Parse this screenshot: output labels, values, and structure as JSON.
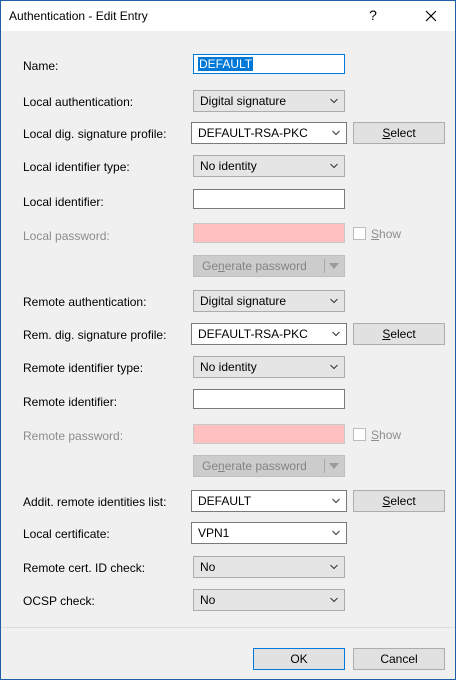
{
  "window": {
    "title": "Authentication - Edit Entry",
    "help_label": "?",
    "close_label": "×"
  },
  "fields": {
    "name": {
      "label": "Name:",
      "value": "DEFAULT"
    },
    "local_authentication": {
      "label": "Local authentication:",
      "value": "Digital signature"
    },
    "local_sig_profile": {
      "label": "Local dig. signature profile:",
      "value": "DEFAULT-RSA-PKC"
    },
    "local_identifier_type": {
      "label": "Local identifier type:",
      "value": "No identity"
    },
    "local_identifier": {
      "label": "Local identifier:",
      "value": ""
    },
    "local_password": {
      "label": "Local password:",
      "value": "",
      "show_label_pre": "",
      "show_label_ul": "S",
      "show_label_post": "how"
    },
    "remote_authentication": {
      "label": "Remote authentication:",
      "value": "Digital signature"
    },
    "remote_sig_profile": {
      "label": "Rem. dig. signature profile:",
      "value": "DEFAULT-RSA-PKC"
    },
    "remote_identifier_type": {
      "label": "Remote identifier type:",
      "value": "No identity"
    },
    "remote_identifier": {
      "label": "Remote identifier:",
      "value": ""
    },
    "remote_password": {
      "label": "Remote password:",
      "value": "",
      "show_label_pre": "",
      "show_label_ul": "S",
      "show_label_post": "how"
    },
    "addit_remote_identities": {
      "label": "Addit. remote identities list:",
      "value": "DEFAULT"
    },
    "local_certificate": {
      "label": "Local certificate:",
      "value": "VPN1"
    },
    "remote_cert_id_check": {
      "label": "Remote cert. ID check:",
      "value": "No"
    },
    "ocsp_check": {
      "label": "OCSP check:",
      "value": "No"
    }
  },
  "buttons": {
    "select_pre": "",
    "select_ul": "S",
    "select_post": "elect",
    "generate_pre": "Ge",
    "generate_ul": "n",
    "generate_post": "erate password",
    "ok": "OK",
    "cancel": "Cancel"
  },
  "colors": {
    "accent": "#0078d7",
    "password_bg": "#ffc0c0",
    "window_border": "#1f5fa8"
  }
}
